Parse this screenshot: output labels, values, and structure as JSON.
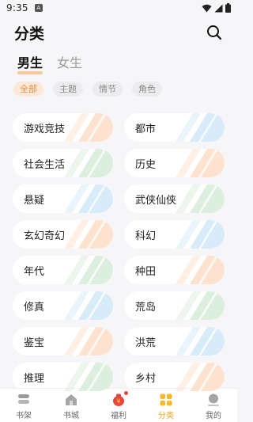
{
  "status": {
    "time": "9:35",
    "notif_letter": "A"
  },
  "header": {
    "title": "分类"
  },
  "gender_tabs": [
    {
      "label": "男生",
      "active": true
    },
    {
      "label": "女生",
      "active": false
    }
  ],
  "filters": [
    {
      "label": "全部",
      "active": true
    },
    {
      "label": "主题",
      "active": false
    },
    {
      "label": "情节",
      "active": false
    },
    {
      "label": "角色",
      "active": false
    }
  ],
  "categories": [
    {
      "label": "游戏竞技",
      "tint": "#fde3cf"
    },
    {
      "label": "都市",
      "tint": "#d7ebf8"
    },
    {
      "label": "社会生活",
      "tint": "#dceedd"
    },
    {
      "label": "历史",
      "tint": "#fde3cf"
    },
    {
      "label": "悬疑",
      "tint": "#d7ebf8"
    },
    {
      "label": "武侠仙侠",
      "tint": "#dceedd"
    },
    {
      "label": "玄幻奇幻",
      "tint": "#fde3cf"
    },
    {
      "label": "科幻",
      "tint": "#d7ebf8"
    },
    {
      "label": "年代",
      "tint": "#dceedd"
    },
    {
      "label": "种田",
      "tint": "#fde3cf"
    },
    {
      "label": "修真",
      "tint": "#d7ebf8"
    },
    {
      "label": "荒岛",
      "tint": "#dceedd"
    },
    {
      "label": "鉴宝",
      "tint": "#fde3cf"
    },
    {
      "label": "洪荒",
      "tint": "#d7ebf8"
    },
    {
      "label": "推理",
      "tint": "#dceedd"
    },
    {
      "label": "乡村",
      "tint": "#fde3cf"
    }
  ],
  "tabbar": [
    {
      "label": "书架",
      "icon": "bookshelf-icon",
      "active": false
    },
    {
      "label": "书城",
      "icon": "bookstore-icon",
      "active": false
    },
    {
      "label": "福利",
      "icon": "welfare-icon",
      "active": false
    },
    {
      "label": "分类",
      "icon": "category-icon",
      "active": true
    },
    {
      "label": "我的",
      "icon": "profile-icon",
      "active": false
    }
  ],
  "colors": {
    "accent": "#f5a623",
    "chip_active": "#f08a3c"
  }
}
